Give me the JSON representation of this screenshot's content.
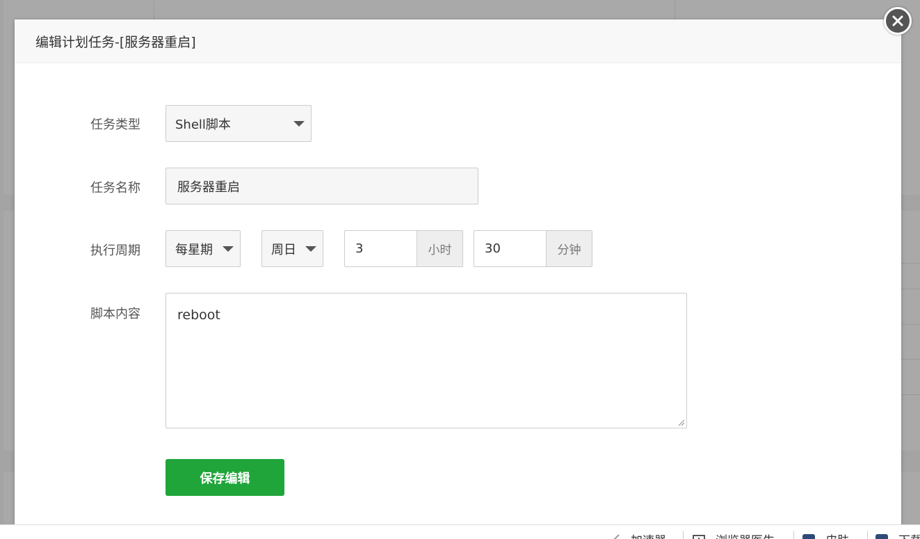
{
  "modal": {
    "title": "编辑计划任务-[服务器重启]"
  },
  "form": {
    "task_type": {
      "label": "任务类型",
      "value": "Shell脚本"
    },
    "task_name": {
      "label": "任务名称",
      "value": "服务器重启"
    },
    "period": {
      "label": "执行周期",
      "cycle": "每星期",
      "weekday": "周日",
      "hour": "3",
      "hour_unit": "小时",
      "minute": "30",
      "minute_unit": "分钟"
    },
    "script": {
      "label": "脚本内容",
      "value": "reboot"
    },
    "save_label": "保存编辑"
  },
  "statusbar": {
    "items": [
      "加速器",
      "浏览器医生",
      "皮肤",
      "下载"
    ]
  },
  "colors": {
    "accent": "#20a53a",
    "overlay": "#a4a4a4",
    "header_bg": "#f8f8f8",
    "close_bg": "#555555"
  }
}
